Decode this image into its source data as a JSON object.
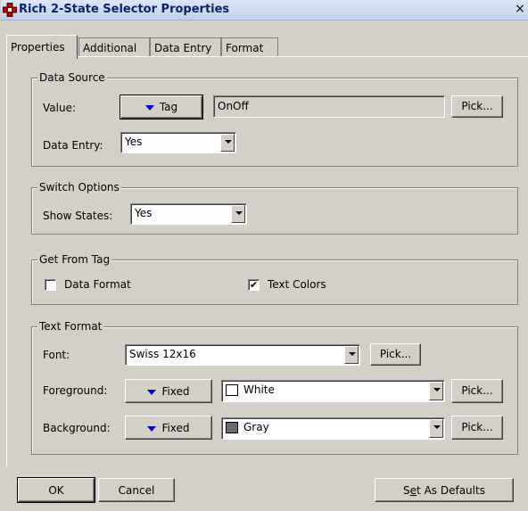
{
  "window": {
    "title": "Rich 2-State Selector Properties",
    "close_glyph": "×"
  },
  "tabs": [
    {
      "label": "Properties"
    },
    {
      "label": "Additional"
    },
    {
      "label": "Data Entry"
    },
    {
      "label": "Format"
    }
  ],
  "data_source": {
    "title": "Data Source",
    "value_label": "Value:",
    "value_mode": "Tag",
    "value_field": "OnOff",
    "pick_label": "Pick...",
    "entry_label": "Data Entry:",
    "entry_value": "Yes"
  },
  "switch_options": {
    "title": "Switch Options",
    "states_label": "Show States:",
    "states_value": "Yes"
  },
  "get_from_tag": {
    "title": "Get From Tag",
    "data_format_label": "Data Format",
    "data_format_checked": false,
    "text_colors_label": "Text Colors",
    "text_colors_checked": true,
    "check_glyph": "✔"
  },
  "text_format": {
    "title": "Text Format",
    "font_label": "Font:",
    "font_value": "Swiss 12x16",
    "font_pick": "Pick...",
    "fg_label": "Foreground:",
    "fg_mode": "Fixed",
    "fg_color_name": "White",
    "fg_color": "#ffffff",
    "fg_pick": "Pick...",
    "bg_label": "Background:",
    "bg_mode": "Fixed",
    "bg_color_name": "Gray",
    "bg_color": "#6b6b6b",
    "bg_pick": "Pick..."
  },
  "buttons": {
    "ok": "OK",
    "cancel": "Cancel",
    "defaults_pre": "S",
    "defaults_mnem": "e",
    "defaults_post": "t As Defaults"
  },
  "colors": {
    "title_text": "#0a246a",
    "tag_triangle": "#0000cc",
    "dialog_bg": "#d4d0c8"
  }
}
